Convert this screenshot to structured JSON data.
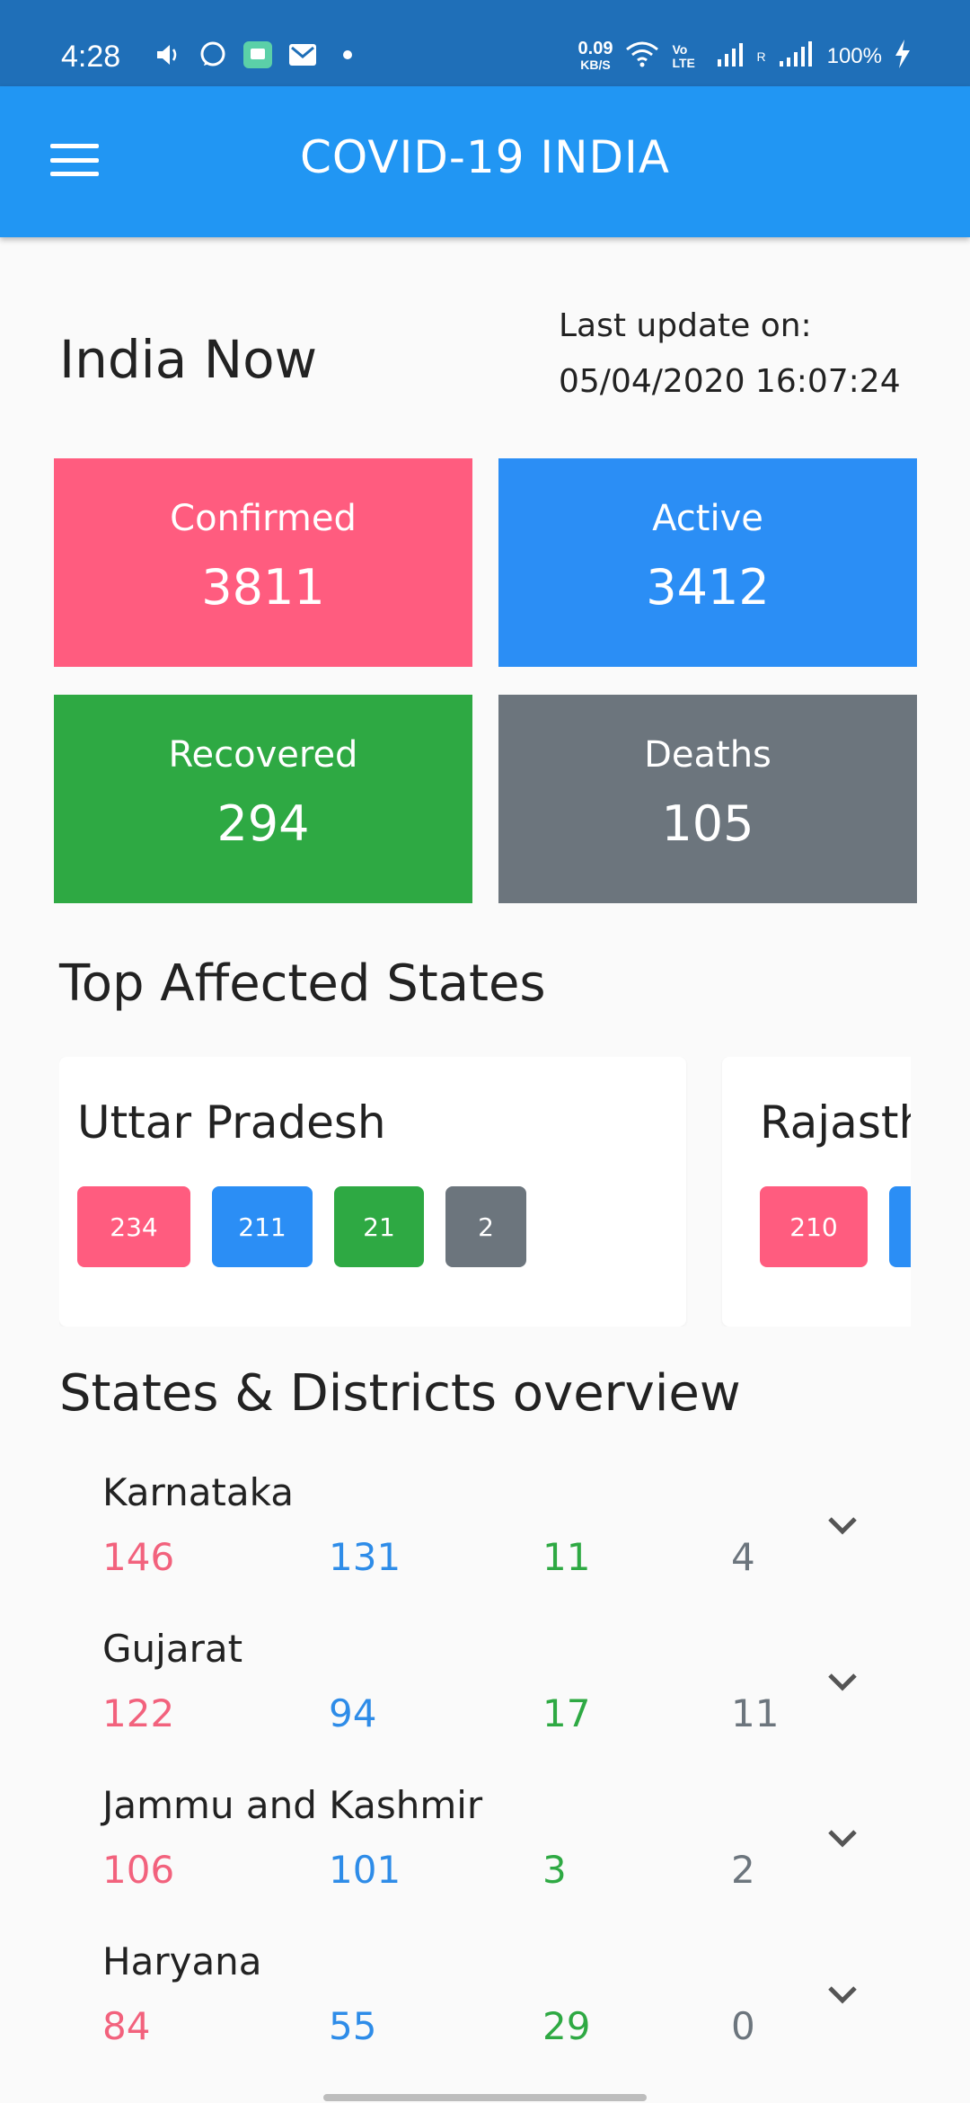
{
  "status_bar": {
    "time": "4:28",
    "speed_value": "0.09",
    "speed_unit": "KB/S",
    "volte": "Vo LTE",
    "roaming": "R",
    "battery": "100%"
  },
  "app_bar": {
    "title": "COVID-19 INDIA",
    "menu_icon": "hamburger-menu-icon"
  },
  "overview": {
    "title": "India Now",
    "last_update_label": "Last update on:",
    "last_update_value": "05/04/2020 16:07:24",
    "stats": {
      "confirmed": {
        "label": "Confirmed",
        "value": "3811",
        "color": "#ff5c7f"
      },
      "active": {
        "label": "Active",
        "value": "3412",
        "color": "#2b8ef5"
      },
      "recovered": {
        "label": "Recovered",
        "value": "294",
        "color": "#2ea943"
      },
      "deaths": {
        "label": "Deaths",
        "value": "105",
        "color": "#6c757d"
      }
    }
  },
  "top_affected": {
    "title": "Top Affected States",
    "cards": [
      {
        "name": "Uttar Pradesh",
        "confirmed": "234",
        "active": "211",
        "recovered": "21",
        "deaths": "2"
      },
      {
        "name": "Rajasthan",
        "confirmed": "210"
      }
    ]
  },
  "states_overview": {
    "title": "States & Districts overview",
    "rows": [
      {
        "name": "Karnataka",
        "confirmed": "146",
        "active": "131",
        "recovered": "11",
        "deaths": "4"
      },
      {
        "name": "Gujarat",
        "confirmed": "122",
        "active": "94",
        "recovered": "17",
        "deaths": "11"
      },
      {
        "name": "Jammu and Kashmir",
        "confirmed": "106",
        "active": "101",
        "recovered": "3",
        "deaths": "2"
      },
      {
        "name": "Haryana",
        "confirmed": "84",
        "active": "55",
        "recovered": "29",
        "deaths": "0"
      }
    ]
  }
}
